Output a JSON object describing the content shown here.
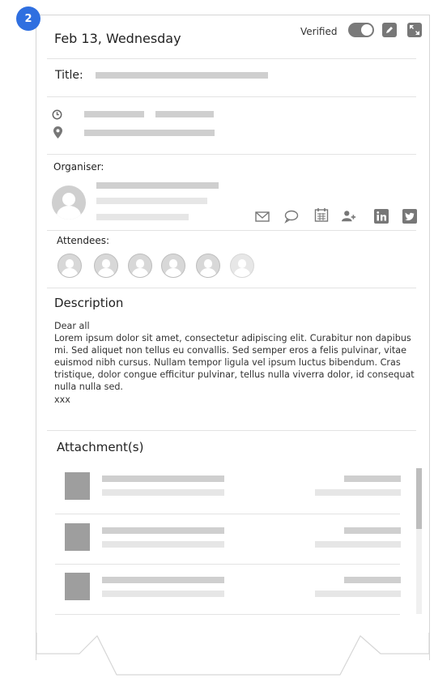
{
  "badge": "2",
  "header": {
    "date": "Feb 13, Wednesday",
    "verified_label": "Verified",
    "icons": [
      "toggle-switch",
      "edit-icon",
      "expand-icon"
    ]
  },
  "title_section": {
    "label": "Title:"
  },
  "organiser_section": {
    "label": "Organiser:",
    "contact_icons": [
      "mail-icon",
      "chat-icon",
      "calendar-icon",
      "add-user-icon",
      "linkedin-icon",
      "twitter-icon"
    ]
  },
  "attendees_section": {
    "label": "Attendees:",
    "count": 6
  },
  "description_section": {
    "label": "Description",
    "greeting": "Dear all",
    "body": "Lorem ipsum dolor sit amet, consectetur adipiscing elit. Curabitur non dapibus mi. Sed aliquet non tellus eu convallis. Sed semper eros a felis pulvinar, vitae euismod nibh cursus. Nullam tempor ligula vel ipsum luctus bibendum. Cras tristique, dolor congue efficitur pulvinar, tellus nulla viverra dolor, id consequat nulla nulla sed.",
    "signoff": "xxx"
  },
  "attachments_section": {
    "label": "Attachment(s)",
    "count": 3
  },
  "colors": {
    "badge": "#2f6fe0",
    "placeholder": "#cfcfcf",
    "toggle": "#7a7a7a"
  }
}
